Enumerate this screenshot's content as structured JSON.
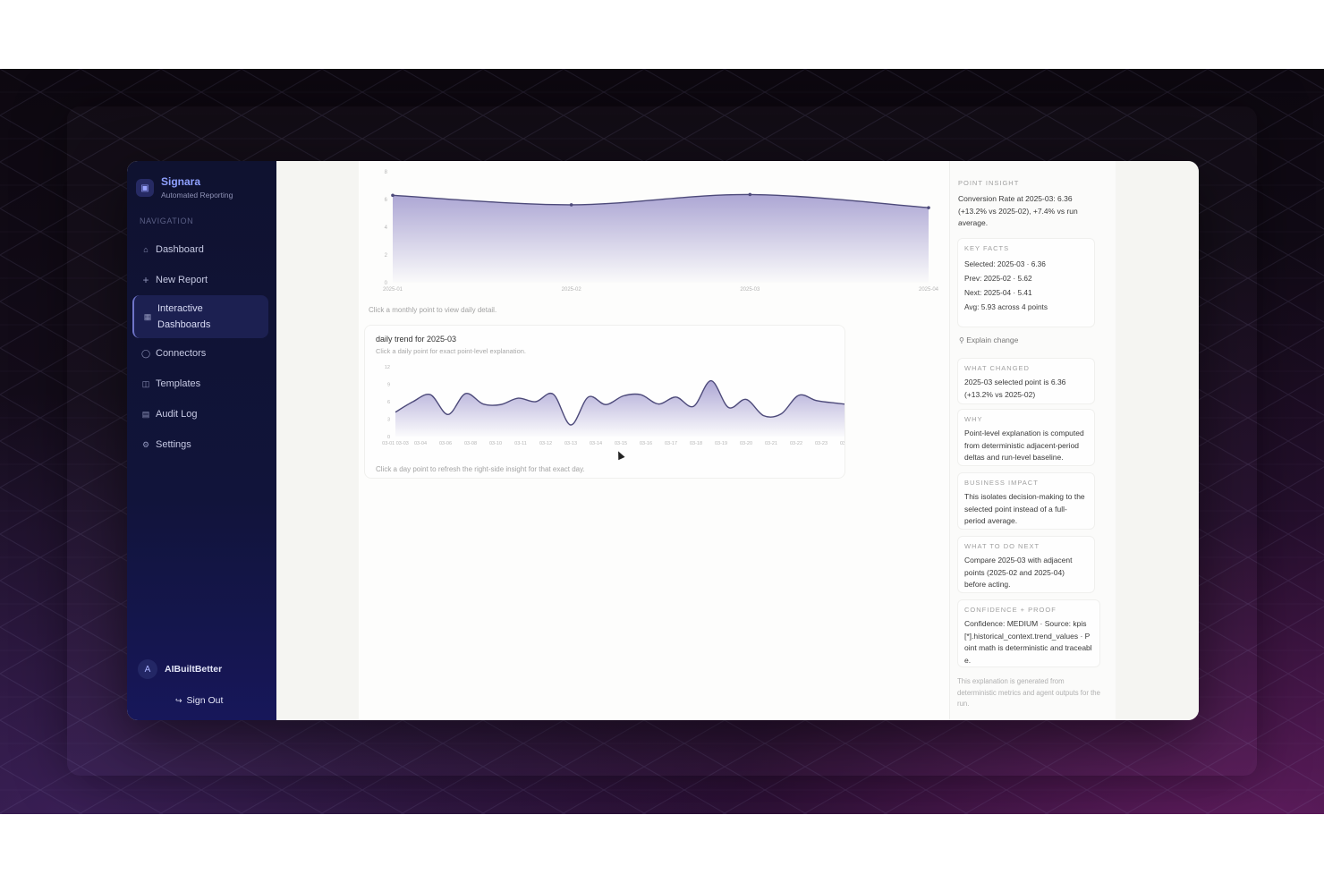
{
  "app": {
    "brand_name": "Signara",
    "brand_sub": "Automated Reporting",
    "brand_icon": "document-icon"
  },
  "sidebar": {
    "section_label": "NAVIGATION",
    "items": [
      {
        "label": "Dashboard",
        "icon": "home-icon"
      },
      {
        "label": "New Report",
        "icon": "plus-icon"
      },
      {
        "label": "Interactive Dashboards",
        "icon": "dashboard-icon",
        "active": true
      },
      {
        "label": "Connectors",
        "icon": "database-icon"
      },
      {
        "label": "Templates",
        "icon": "template-icon"
      },
      {
        "label": "Audit Log",
        "icon": "file-icon"
      },
      {
        "label": "Settings",
        "icon": "gear-icon"
      }
    ],
    "user": {
      "initial": "A",
      "name": "AIBuiltBetter"
    },
    "sign_out": "Sign Out"
  },
  "monthly": {
    "hint": "Click a monthly point to view daily detail."
  },
  "daily": {
    "title": "daily trend for 2025-03",
    "subtitle": "Click a daily point for exact point-level explanation.",
    "hint": "Click a day point to refresh the right-side insight for that exact day."
  },
  "chart_data": [
    {
      "type": "area",
      "x": [
        "2025-01",
        "2025-02",
        "2025-03",
        "2025-04"
      ],
      "values": [
        6.3,
        5.62,
        6.36,
        5.41
      ],
      "yticks": [
        0,
        2,
        4,
        6,
        8
      ],
      "ylim": [
        0,
        8
      ],
      "color": "#6a5fb3"
    },
    {
      "type": "area",
      "x": [
        "03-01",
        "03-02",
        "03-03",
        "03-04",
        "03-05",
        "03-06",
        "03-07",
        "03-08",
        "03-09",
        "03-10",
        "03-11",
        "03-12",
        "03-13",
        "03-14",
        "03-15",
        "03-16",
        "03-17",
        "03-18",
        "03-19",
        "03-20",
        "03-21",
        "03-22",
        "03-23",
        "03-24",
        "03-25",
        "03-26",
        "03-27",
        "03-28",
        "03-29",
        "03-30",
        "03-31"
      ],
      "xtick_labels": [
        "03-01 03-03",
        "03-04",
        "03-06",
        "03-08",
        "03-10",
        "03-11",
        "03-12",
        "03-13",
        "03-14",
        "03-15",
        "03-16",
        "03-17",
        "03-18",
        "03-19",
        "03-20",
        "03-21",
        "03-22",
        "03-23",
        "03-25",
        "03-27",
        "03-29",
        "03-31"
      ],
      "values": [
        4.2,
        6.0,
        7.2,
        3.8,
        7.4,
        5.6,
        5.5,
        6.6,
        6.0,
        7.3,
        2.0,
        6.8,
        5.5,
        7.0,
        7.2,
        5.6,
        6.8,
        5.2,
        9.6,
        5.0,
        6.4,
        3.6,
        3.9,
        7.1,
        6.2,
        5.8,
        5.6,
        6.6,
        4.2,
        4.2,
        4.1
      ],
      "yticks": [
        0,
        3,
        6,
        9,
        12
      ],
      "ylim": [
        0,
        12
      ],
      "color": "#6a5fb3"
    }
  ],
  "insight": {
    "heading": "POINT INSIGHT",
    "summary": "Conversion Rate at 2025-03: 6.36 (+13.2% vs 2025-02), +7.4% vs run average.",
    "key_facts_heading": "KEY FACTS",
    "facts": [
      "Selected: 2025-03 · 6.36",
      "Prev: 2025-02 · 5.62",
      "Next: 2025-04 · 5.41",
      "Avg: 5.93 across 4 points"
    ],
    "explain_button": "Explain change",
    "sections": [
      {
        "heading": "WHAT CHANGED",
        "text": "2025-03 selected point is 6.36 (+13.2% vs 2025-02)"
      },
      {
        "heading": "WHY",
        "text": "Point-level explanation is computed from deterministic adjacent-period deltas and run-level baseline."
      },
      {
        "heading": "BUSINESS IMPACT",
        "text": "This isolates decision-making to the selected point instead of a full-period average."
      },
      {
        "heading": "WHAT TO DO NEXT",
        "text": "Compare 2025-03 with adjacent points (2025-02 and 2025-04) before acting."
      },
      {
        "heading": "CONFIDENCE + PROOF",
        "text": "Confidence: MEDIUM · Source: kpis[*].historical_context.trend_values · Point math is deterministic and traceable."
      }
    ],
    "footer": "This explanation is generated from deterministic metrics and agent outputs for the run."
  }
}
